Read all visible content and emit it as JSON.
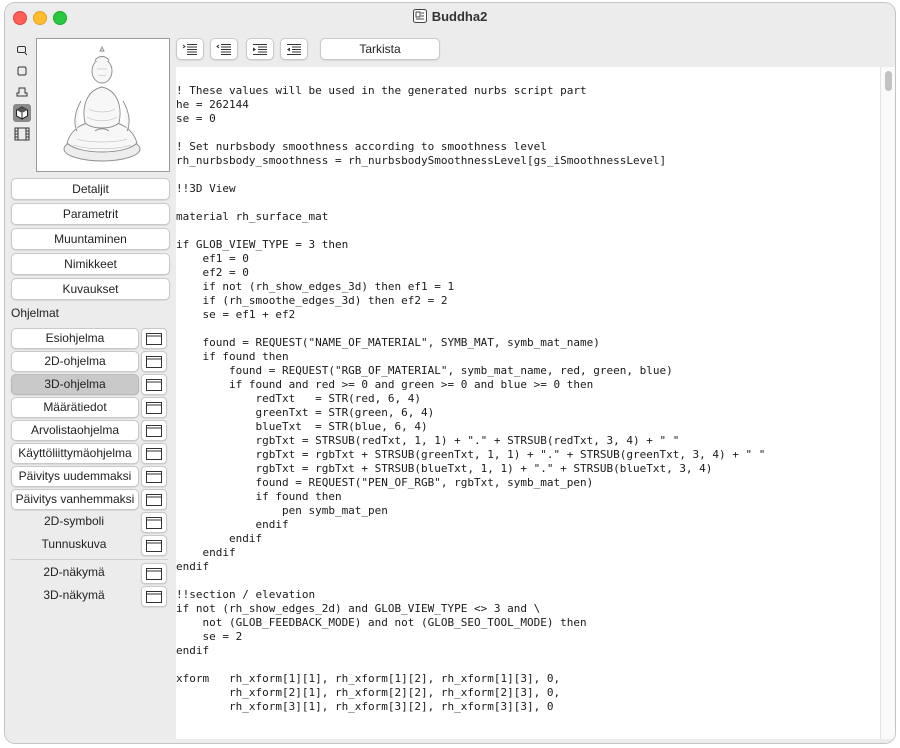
{
  "window": {
    "title": "Buddha2"
  },
  "toolbar": {
    "check_label": "Tarkista"
  },
  "sidebar": {
    "nav_buttons": [
      "Detaljit",
      "Parametrit",
      "Muuntaminen",
      "Nimikkeet",
      "Kuvaukset"
    ],
    "section_label": "Ohjelmat",
    "programs": [
      "Esiohjelma",
      "2D-ohjelma",
      "3D-ohjelma",
      "Määrätiedot",
      "Arvolistaohjelma",
      "Käyttöliittymäohjelma",
      "Päivitys uudemmaksi",
      "Päivitys vanhemmaksi",
      "2D-symboli",
      "Tunnuskuva",
      "2D-näkymä",
      "3D-näkymä"
    ],
    "selected_program": "3D-ohjelma"
  },
  "editor": {
    "lines": [
      "",
      "! These values will be used in the generated nurbs script part",
      "he = 262144",
      "se = 0",
      "",
      "! Set nurbsbody smoothness according to smoothness level",
      "rh_nurbsbody_smoothness = rh_nurbsbodySmoothnessLevel[gs_iSmoothnessLevel]",
      "",
      "!!3D View",
      "",
      "material rh_surface_mat",
      "",
      "if GLOB_VIEW_TYPE = 3 then",
      "    ef1 = 0",
      "    ef2 = 0",
      "    if not (rh_show_edges_3d) then ef1 = 1",
      "    if (rh_smoothe_edges_3d) then ef2 = 2",
      "    se = ef1 + ef2",
      "",
      "    found = REQUEST(\"NAME_OF_MATERIAL\", SYMB_MAT, symb_mat_name)",
      "    if found then",
      "        found = REQUEST(\"RGB_OF_MATERIAL\", symb_mat_name, red, green, blue)",
      "        if found and red >= 0 and green >= 0 and blue >= 0 then",
      "            redTxt   = STR(red, 6, 4)",
      "            greenTxt = STR(green, 6, 4)",
      "            blueTxt  = STR(blue, 6, 4)",
      "            rgbTxt = STRSUB(redTxt, 1, 1) + \".\" + STRSUB(redTxt, 3, 4) + \" \"",
      "            rgbTxt = rgbTxt + STRSUB(greenTxt, 1, 1) + \".\" + STRSUB(greenTxt, 3, 4) + \" \"",
      "            rgbTxt = rgbTxt + STRSUB(blueTxt, 1, 1) + \".\" + STRSUB(blueTxt, 3, 4)",
      "            found = REQUEST(\"PEN_OF_RGB\", rgbTxt, symb_mat_pen)",
      "            if found then",
      "                pen symb_mat_pen",
      "            endif",
      "        endif",
      "    endif",
      "endif",
      "",
      "!!section / elevation",
      "if not (rh_show_edges_2d) and GLOB_VIEW_TYPE <> 3 and \\",
      "    not (GLOB_FEEDBACK_MODE) and not (GLOB_SEO_TOOL_MODE) then",
      "    se = 2",
      "endif",
      "",
      "xform   rh_xform[1][1], rh_xform[1][2], rh_xform[1][3], 0,",
      "        rh_xform[2][1], rh_xform[2][2], rh_xform[2][3], 0,",
      "        rh_xform[3][1], rh_xform[3][2], rh_xform[3][3], 0"
    ]
  },
  "icons": {
    "tools": [
      "select-2d-icon",
      "rectangle-icon",
      "object-icon",
      "cube-3d-icon",
      "filmstrip-icon"
    ],
    "toolbar": [
      "indent-list-icon",
      "outdent-list-icon",
      "indent-right-icon",
      "outdent-left-icon"
    ]
  },
  "colors": {
    "selected_program_bg": "#c9c9c9",
    "active_tool_bg": "#8a8a8a"
  }
}
